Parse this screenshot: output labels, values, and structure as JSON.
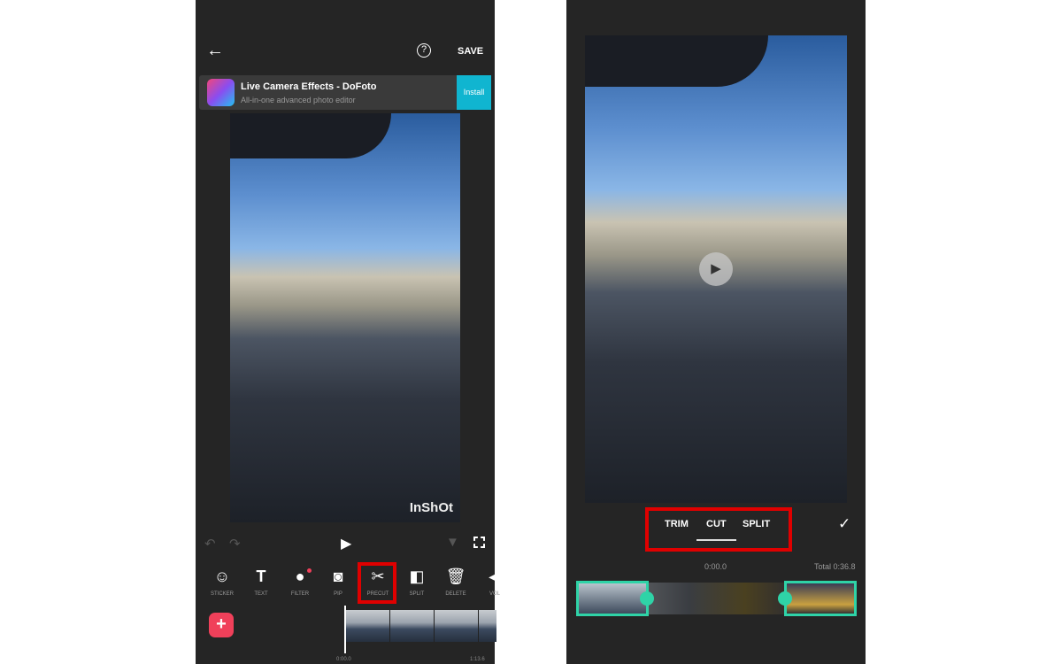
{
  "left": {
    "header": {
      "back_icon": "arrow-left",
      "help_icon": "question-circle",
      "save_label": "SAVE"
    },
    "ad": {
      "title": "Live Camera Effects - DoFoto",
      "subtitle": "All-in-one advanced photo editor",
      "install_label": "Install"
    },
    "watermark": "InShOt",
    "controls": {
      "undo": "undo",
      "redo": "redo",
      "play": "play",
      "keyframe": "keyframe",
      "fullscreen": "fullscreen"
    },
    "tools": [
      {
        "label": "STICKER",
        "icon": "☺"
      },
      {
        "label": "TEXT",
        "icon": "T"
      },
      {
        "label": "FILTER",
        "icon": "●"
      },
      {
        "label": "PIP",
        "icon": "◙"
      },
      {
        "label": "PRECUT",
        "icon": "✂"
      },
      {
        "label": "SPLIT",
        "icon": "◧"
      },
      {
        "label": "DELETE",
        "icon": "🗑"
      },
      {
        "label": "VOL",
        "icon": "◀"
      }
    ],
    "timeline": {
      "start": "0:00.0",
      "end": "1:13.6"
    },
    "highlight_color": "#e00000",
    "add_button_color": "#f0405a"
  },
  "right": {
    "tabs": [
      "TRIM",
      "CUT",
      "SPLIT"
    ],
    "active_tab": "CUT",
    "current_time": "0:00.0",
    "total": "Total 0:36.8",
    "accent": "#2fd3a7"
  }
}
